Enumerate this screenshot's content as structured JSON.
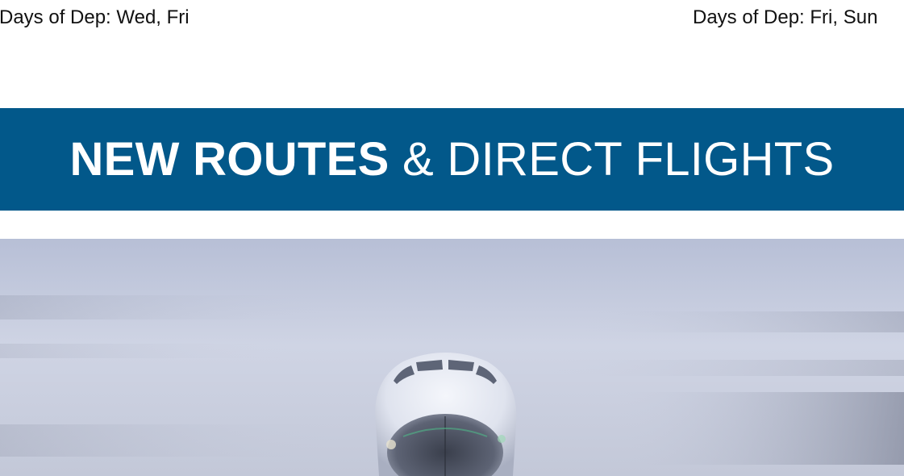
{
  "departures": {
    "left": "Days of Dep: Wed, Fri",
    "right": "Days of Dep: Fri, Sun"
  },
  "banner": {
    "title_bold": "NEW ROUTES",
    "title_rest": " & DIRECT FLIGHTS"
  },
  "hero": {
    "icon": "airplane-front-photo"
  },
  "colors": {
    "banner_bg": "#02588a",
    "banner_text": "#ffffff",
    "sky": "#c9cfe0"
  }
}
